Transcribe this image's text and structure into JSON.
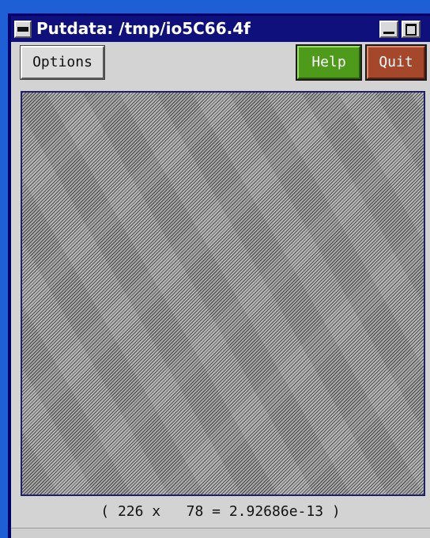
{
  "window": {
    "title": "Putdata: /tmp/io5C66.4f"
  },
  "toolbar": {
    "options_label": "Options",
    "help_label": "Help",
    "quit_label": "Quit"
  },
  "status": {
    "text": "( 226 x   78 = 2.92686e-13 )"
  },
  "colors": {
    "desktop": "#1f5fd6",
    "titlebar": "#10107c",
    "client": "#d3d3d3",
    "help_button": "#4e9a1a",
    "quit_button": "#a5472a"
  },
  "icons": {
    "window_menu": "window-menu-icon",
    "minimize": "minimize-icon",
    "maximize": "maximize-icon"
  }
}
